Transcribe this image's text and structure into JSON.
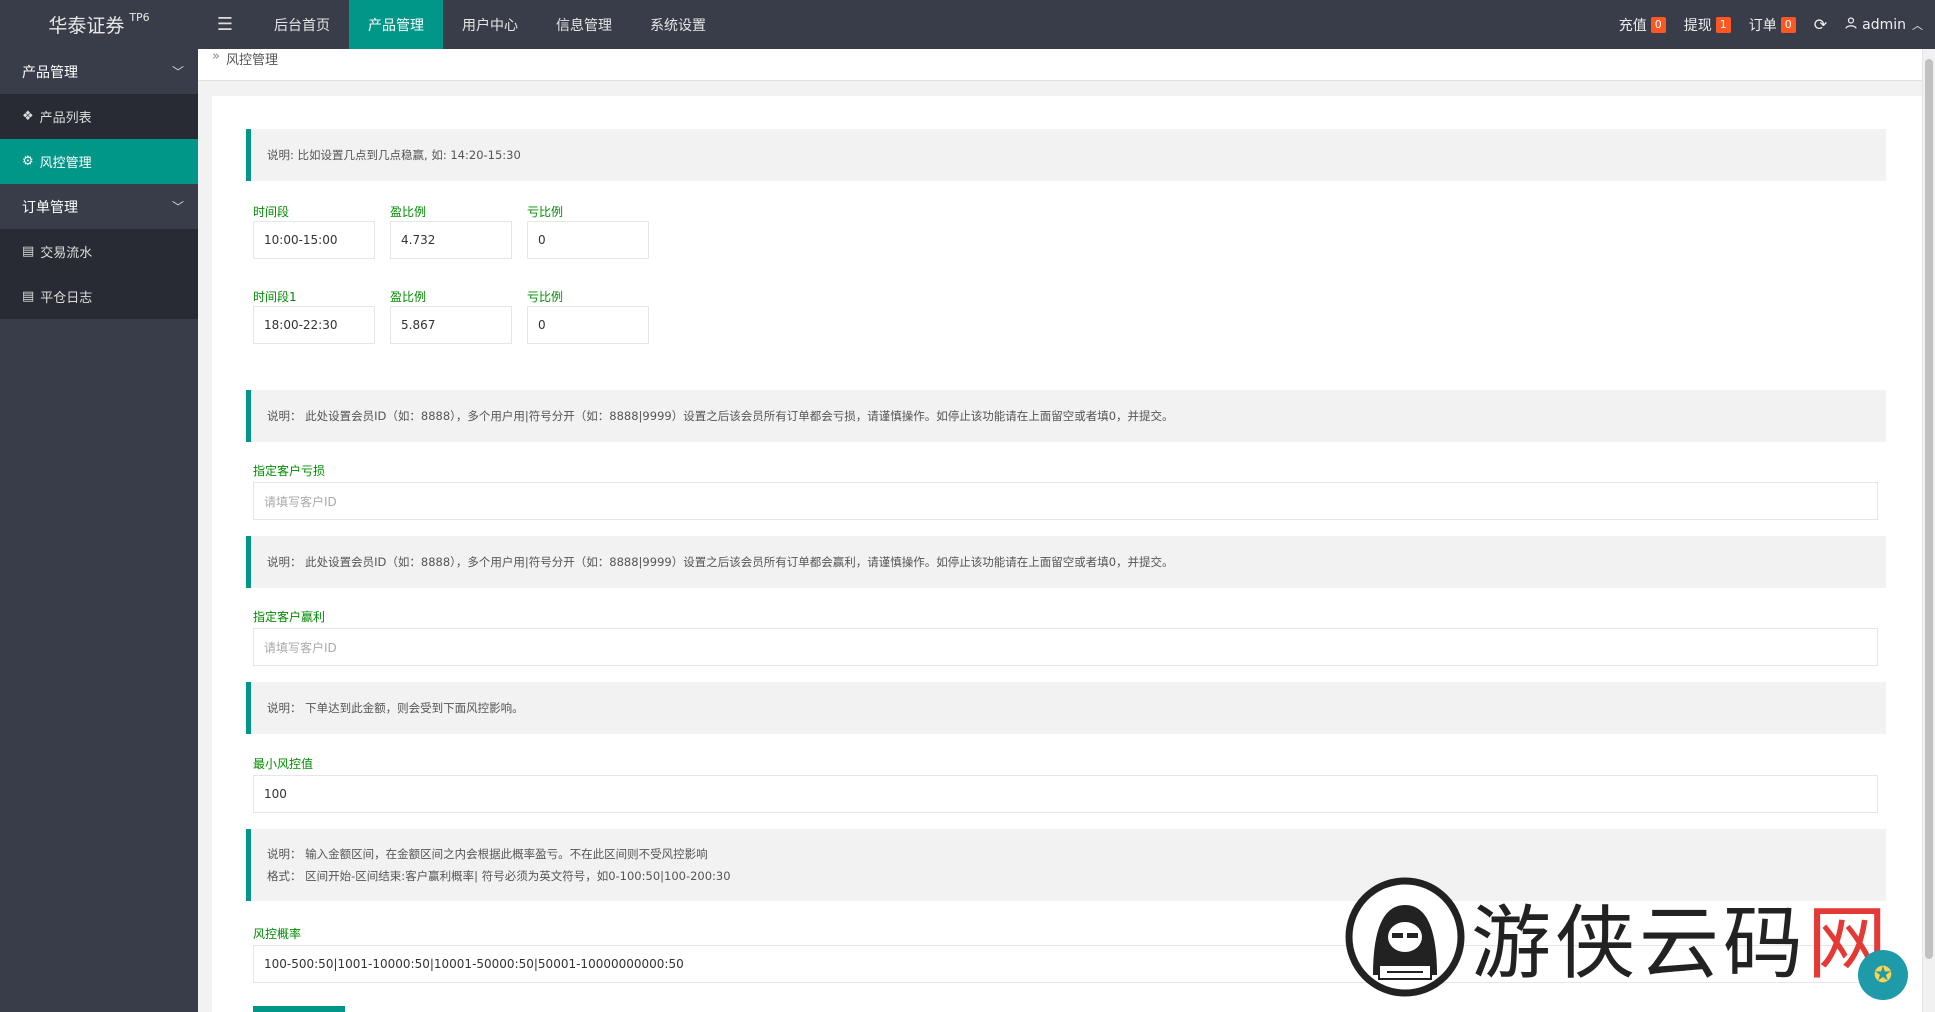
{
  "app": {
    "title": "华泰证券",
    "version": "TP6"
  },
  "topnav": [
    "后台首页",
    "产品管理",
    "用户中心",
    "信息管理",
    "系统设置"
  ],
  "topright": {
    "recharge_label": "充值",
    "recharge_count": "0",
    "withdraw_label": "提现",
    "withdraw_count": "1",
    "order_label": "订单",
    "order_count": "0",
    "user": "admin"
  },
  "sidebar": {
    "group1": "产品管理",
    "group1_items": [
      "产品列表",
      "风控管理"
    ],
    "group2": "订单管理",
    "group2_items": [
      "交易流水",
      "平仓日志"
    ]
  },
  "breadcrumb": "风控管理",
  "notes": {
    "n1": "说明: 比如设置几点到几点稳赢, 如: 14:20-15:30",
    "n2": "说明：  此处设置会员ID（如：8888），多个用户用|符号分开（如：8888|9999）设置之后该会员所有订单都会亏损，请谨慎操作。如停止该功能请在上面留空或者填0，并提交。",
    "n3": "说明：  此处设置会员ID（如：8888），多个用户用|符号分开（如：8888|9999）设置之后该会员所有订单都会赢利，请谨慎操作。如停止该功能请在上面留空或者填0，并提交。",
    "n4": "说明：  下单达到此金额，则会受到下面风控影响。",
    "n5a": "说明：  输入金额区间，在金额区间之内会根据此概率盈亏。不在此区间则不受风控影响",
    "n5b": "格式：  区间开始-区间结束:客户赢利概率|        符号必须为英文符号，如0-100:50|100-200:30"
  },
  "row1": {
    "l_time": "时间段",
    "l_win": "盈比例",
    "l_lose": "亏比例",
    "time": "10:00-15:00",
    "win": "4.732",
    "lose": "0"
  },
  "row2": {
    "l_time": "时间段1",
    "l_win": "盈比例",
    "l_lose": "亏比例",
    "time": "18:00-22:30",
    "win": "5.867",
    "lose": "0"
  },
  "loss_client": {
    "label": "指定客户亏损",
    "placeholder": "请填写客户ID"
  },
  "win_client": {
    "label": "指定客户赢利",
    "placeholder": "请填写客户ID"
  },
  "min_risk": {
    "label": "最小风控值",
    "value": "100"
  },
  "risk_prob": {
    "label": "风控概率",
    "value": "100-500:50|1001-10000:50|10001-50000:50|50001-10000000000:50"
  },
  "watermark": {
    "text_a": "游侠云码",
    "text_b": "网"
  }
}
